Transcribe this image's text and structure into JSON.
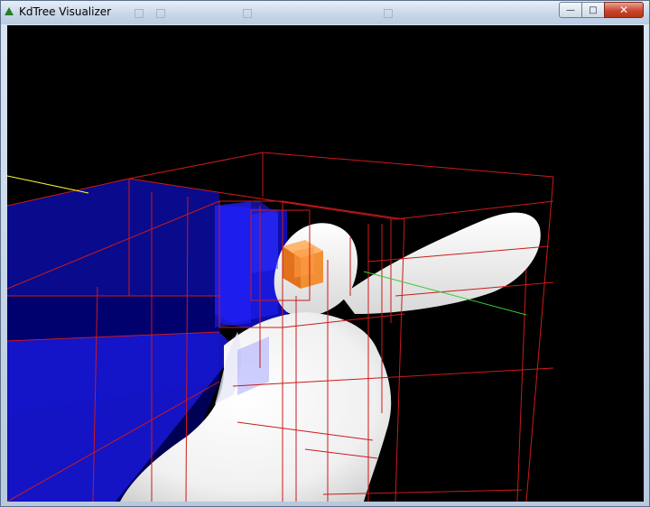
{
  "window": {
    "title": "KdTree Visualizer",
    "minimize_glyph": "—",
    "maximize_glyph": "□",
    "close_glyph": "✕"
  },
  "viewport": {
    "background": "#000000",
    "mesh_color": "#ffffff",
    "node_box_color": "#cc1a1a",
    "filled_cell_color": "#1a1aff",
    "highlight_cell_color": "#f07a1a",
    "axis_colors": [
      "#ffff33",
      "#33cc33"
    ]
  }
}
